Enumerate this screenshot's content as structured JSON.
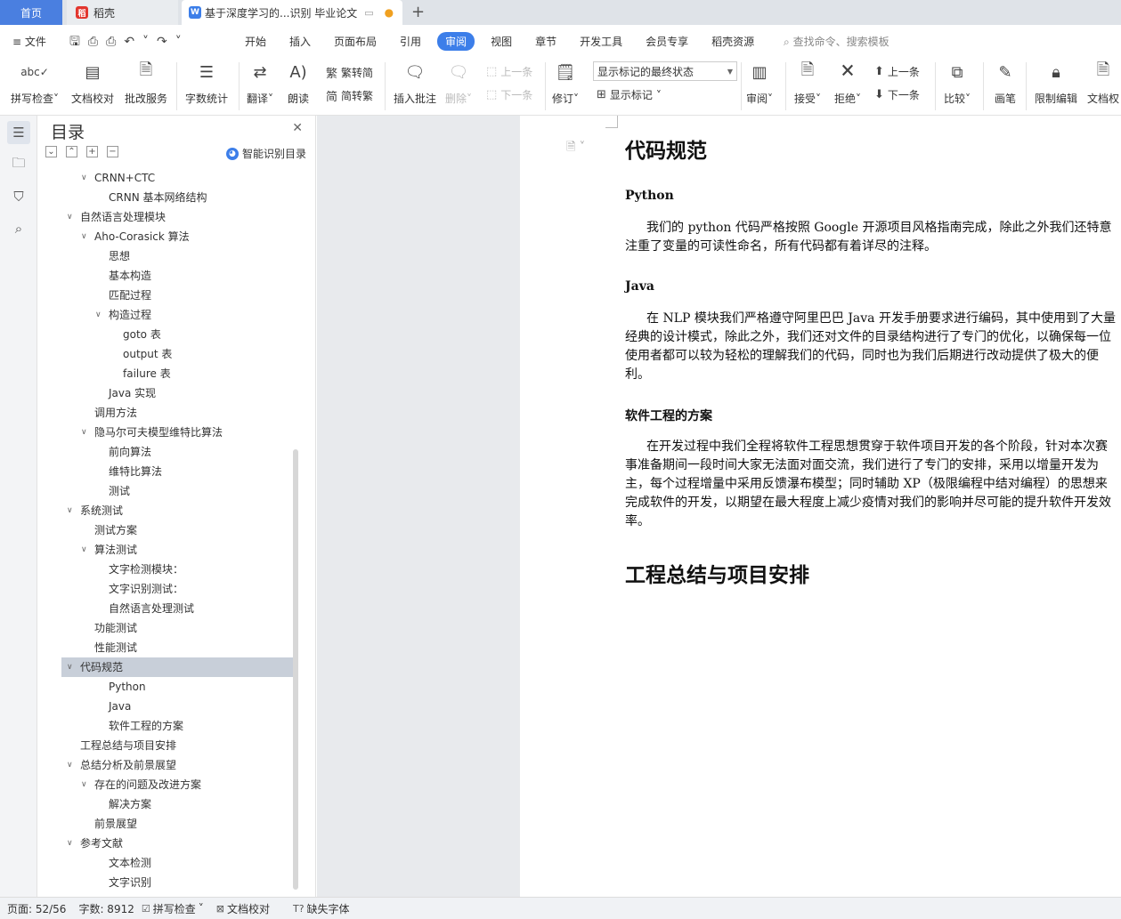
{
  "tabs": {
    "home": "首页",
    "daoke": "稻壳",
    "doc": "基于深度学习的...识别 毕业论文"
  },
  "menu": {
    "file": "文件",
    "ribbon_tabs": [
      "开始",
      "插入",
      "页面布局",
      "引用",
      "审阅",
      "视图",
      "章节",
      "开发工具",
      "会员专享",
      "稻壳资源"
    ],
    "active_tab": "审阅",
    "search": "查找命令、搜索模板"
  },
  "ribbon": {
    "spellcheck": "拼写检查",
    "doccheck": "文档校对",
    "review_service": "批改服务",
    "wordcount": "字数统计",
    "translate": "翻译",
    "read_aloud": "朗读",
    "trad": "繁转简",
    "simp": "简转繁",
    "insert_comment": "插入批注",
    "delete": "删除",
    "prev_comment": "上一条",
    "next_comment": "下一条",
    "track": "修订",
    "markup_state": "显示标记的最终状态",
    "show_markup": "显示标记",
    "review": "审阅",
    "accept": "接受",
    "reject": "拒绝",
    "prev_change": "上一条",
    "next_change": "下一条",
    "compare": "比较",
    "pen": "画笔",
    "restrict": "限制编辑",
    "permission": "文档权"
  },
  "nav": {
    "title": "目录",
    "smart_toc": "智能识别目录",
    "items": [
      {
        "text": "CRNN+CTC",
        "level": 2,
        "caret": true
      },
      {
        "text": "CRNN 基本网络结构",
        "level": 3,
        "caret": false
      },
      {
        "text": "自然语言处理模块",
        "level": 1,
        "caret": true
      },
      {
        "text": "Aho-Corasick 算法",
        "level": 2,
        "caret": true
      },
      {
        "text": "思想",
        "level": 3,
        "caret": false
      },
      {
        "text": "基本构造",
        "level": 3,
        "caret": false
      },
      {
        "text": "匹配过程",
        "level": 3,
        "caret": false
      },
      {
        "text": "构造过程",
        "level": 3,
        "caret": true
      },
      {
        "text": "goto 表",
        "level": 4,
        "caret": false
      },
      {
        "text": "output 表",
        "level": 4,
        "caret": false
      },
      {
        "text": "failure 表",
        "level": 4,
        "caret": false
      },
      {
        "text": "Java 实现",
        "level": 3,
        "caret": false
      },
      {
        "text": "调用方法",
        "level": 2,
        "caret": false
      },
      {
        "text": "隐马尔可夫模型维特比算法",
        "level": 2,
        "caret": true
      },
      {
        "text": "前向算法",
        "level": 3,
        "caret": false
      },
      {
        "text": "维特比算法",
        "level": 3,
        "caret": false
      },
      {
        "text": "测试",
        "level": 3,
        "caret": false
      },
      {
        "text": "系统测试",
        "level": 1,
        "caret": true
      },
      {
        "text": "测试方案",
        "level": 2,
        "caret": false
      },
      {
        "text": "算法测试",
        "level": 2,
        "caret": true
      },
      {
        "text": "文字检测模块：",
        "level": 3,
        "caret": false
      },
      {
        "text": "文字识别测试：",
        "level": 3,
        "caret": false
      },
      {
        "text": "自然语言处理测试",
        "level": 3,
        "caret": false
      },
      {
        "text": "功能测试",
        "level": 2,
        "caret": false
      },
      {
        "text": "性能测试",
        "level": 2,
        "caret": false
      },
      {
        "text": "代码规范",
        "level": 1,
        "caret": true,
        "selected": true
      },
      {
        "text": "Python",
        "level": 3,
        "caret": false
      },
      {
        "text": "Java",
        "level": 3,
        "caret": false
      },
      {
        "text": "软件工程的方案",
        "level": 3,
        "caret": false
      },
      {
        "text": "工程总结与项目安排",
        "level": 1,
        "caret": false
      },
      {
        "text": "总结分析及前景展望",
        "level": 1,
        "caret": true
      },
      {
        "text": "存在的问题及改进方案",
        "level": 2,
        "caret": true
      },
      {
        "text": "解决方案",
        "level": 3,
        "caret": false
      },
      {
        "text": "前景展望",
        "level": 2,
        "caret": false
      },
      {
        "text": "参考文献",
        "level": 1,
        "caret": true
      },
      {
        "text": "文本检测",
        "level": 3,
        "caret": false
      },
      {
        "text": "文字识别",
        "level": 3,
        "caret": false
      }
    ]
  },
  "doc": {
    "h_code": "代码规范",
    "h_python": "Python",
    "p_python": "我们的 python 代码严格按照 Google 开源项目风格指南完成，除此之外我们还特意注重了变量的可读性命名，所有代码都有着详尽的注释。",
    "h_java": "Java",
    "p_java": "在 NLP 模块我们严格遵守阿里巴巴 Java 开发手册要求进行编码，其中使用到了大量经典的设计模式，除此之外，我们还对文件的目录结构进行了专门的优化，以确保每一位使用者都可以较为轻松的理解我们的代码，同时也为我们后期进行改动提供了极大的便利。",
    "h_se": "软件工程的方案",
    "p_se": "在开发过程中我们全程将软件工程思想贯穿于软件项目开发的各个阶段，针对本次赛事准备期间一段时间大家无法面对面交流，我们进行了专门的安排，采用以增量开发为主，每个过程增量中采用反馈瀑布模型；同时辅助 XP（极限编程中结对编程）的思想来完成软件的开发，以期望在最大程度上减少疫情对我们的影响并尽可能的提升软件开发效率。",
    "h_summary": "工程总结与项目安排"
  },
  "status": {
    "page": "页面: 52/56",
    "words": "字数: 8912",
    "spell": "拼写检查",
    "doccheck": "文档校对",
    "missing_font": "缺失字体"
  }
}
